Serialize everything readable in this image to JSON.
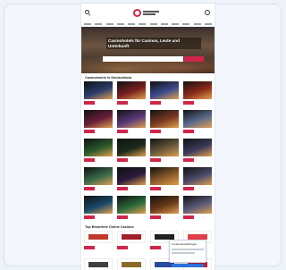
{
  "page": {
    "hero": {
      "title": "Casinohotels für Casinos, Leute und Unterkunft",
      "search_placeholder": ""
    },
    "section_hotels": "Casinohotels in Deutschland",
    "section_partners": "Top Bewertete Online Casinos",
    "popup_title": "Cookie-Einstellungen"
  },
  "colors": {
    "accent": "#d0254a",
    "background": "#eef2f9",
    "popup_button": "#2f6fd8"
  },
  "hotels": [
    {
      "color": "#2a3d6b"
    },
    {
      "color": "#7a2020"
    },
    {
      "color": "#3b4a8a"
    },
    {
      "color": "#8a2a1a"
    },
    {
      "color": "#6a1f3a"
    },
    {
      "color": "#5a3a7a"
    },
    {
      "color": "#7a3a22"
    },
    {
      "color": "#5a6a8a"
    },
    {
      "color": "#2a5a2a"
    },
    {
      "color": "#1a2a1a"
    },
    {
      "color": "#6a5a3a"
    },
    {
      "color": "#3a3a5a"
    },
    {
      "color": "#3a6a4a"
    },
    {
      "color": "#2a1a3a"
    },
    {
      "color": "#8a5a2a"
    },
    {
      "color": "#4a4a6a"
    },
    {
      "color": "#1a4a6a"
    },
    {
      "color": "#2a6a3a"
    },
    {
      "color": "#6a3a1a"
    },
    {
      "color": "#5a5a7a"
    }
  ],
  "partners": [
    {
      "color": "#c0392b"
    },
    {
      "color": "#a0202a"
    },
    {
      "color": "#202020"
    },
    {
      "color": "#e0404a"
    },
    {
      "color": "#404040"
    },
    {
      "color": "#8a6a2a"
    },
    {
      "color": "#2a4aa0"
    },
    {
      "color": "#c02030"
    }
  ]
}
